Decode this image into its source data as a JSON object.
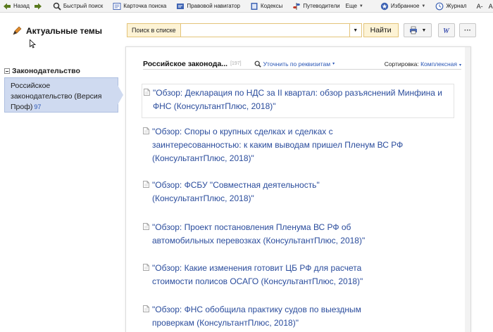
{
  "toolbar": {
    "back": "Назад",
    "quick_search": "Быстрый поиск",
    "search_card": "Карточка поиска",
    "legal_navigator": "Правовой навигатор",
    "codes": "Кодексы",
    "guides": "Путеводители",
    "more": "Еще",
    "favorites": "Избранное",
    "journal": "Журнал",
    "font_smaller": "A-",
    "font_larger": "A+"
  },
  "sidebar": {
    "title": "Актуальные темы",
    "section": "Законодательство",
    "item_label": "Российское законодательство (Версия Проф)",
    "item_count": "97"
  },
  "search": {
    "label": "Поиск в списке",
    "value": "",
    "button": "Найти"
  },
  "list": {
    "title": "Российское законода...",
    "count": "[197]",
    "refine_label": "Уточнить по реквизитам",
    "sort_label": "Сортировка:",
    "sort_value": "Комплексная",
    "documents": [
      {
        "title": "\"Обзор: Декларация по НДС за II квартал: обзор разъяснений Минфина и ФНС (КонсультантПлюс, 2018)\""
      },
      {
        "title": "\"Обзор: Споры о крупных сделках и сделках с заинтересованностью: к каким выводам пришел Пленум ВС РФ (КонсультантПлюс, 2018)\""
      },
      {
        "title": "\"Обзор: ФСБУ \"Совместная деятельность\" (КонсультантПлюс, 2018)\""
      },
      {
        "title": "\"Обзор: Проект постановления Пленума ВС РФ об автомобильных перевозках (КонсультантПлюс, 2018)\""
      },
      {
        "title": "\"Обзор: Какие изменения готовит ЦБ РФ для расчета стоимости полисов ОСАГО (КонсультантПлюс, 2018)\""
      },
      {
        "title": "\"Обзор: ФНС обобщила практику судов по выездным проверкам (КонсультантПлюс, 2018)\""
      }
    ]
  }
}
